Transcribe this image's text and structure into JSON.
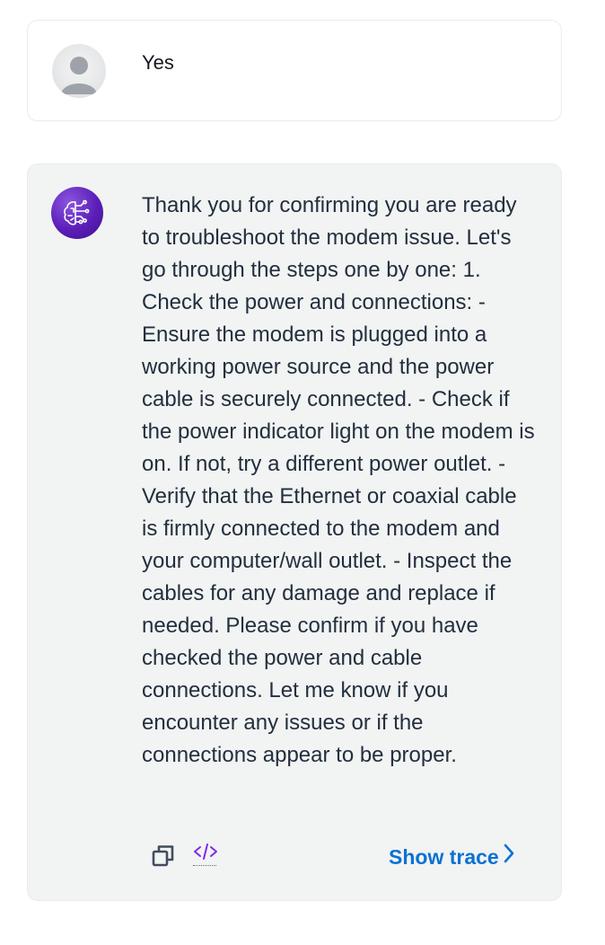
{
  "messages": [
    {
      "role": "user",
      "text": "Yes",
      "avatar_icon": "user-avatar-icon"
    },
    {
      "role": "assistant",
      "avatar_icon": "ai-brain-circuit-icon",
      "text": "Thank you for confirming you are ready to troubleshoot the modem issue. Let's go through the steps one by one: 1. Check the power and connections: - Ensure the modem is plugged into a working power source and the power cable is securely connected. - Check if the power indicator light on the modem is on. If not, try a different power outlet. - Verify that the Ethernet or coaxial cable is firmly connected to the modem and your computer/wall outlet. - Inspect the cables for any damage and replace if needed. Please confirm if you have checked the power and cable connections. Let me know if you encounter any issues or if the connections appear to be proper.",
      "actions": {
        "copy_icon": "copy-icon",
        "code_icon": "code-icon",
        "show_trace_label": "Show trace",
        "chevron_icon": "chevron-right-icon"
      }
    }
  ],
  "colors": {
    "link": "#0972d3",
    "assistant_bg": "#f2f3f3",
    "text": "#232f3e",
    "border": "#e9ebed",
    "bot_avatar": "#5b1fb8"
  }
}
